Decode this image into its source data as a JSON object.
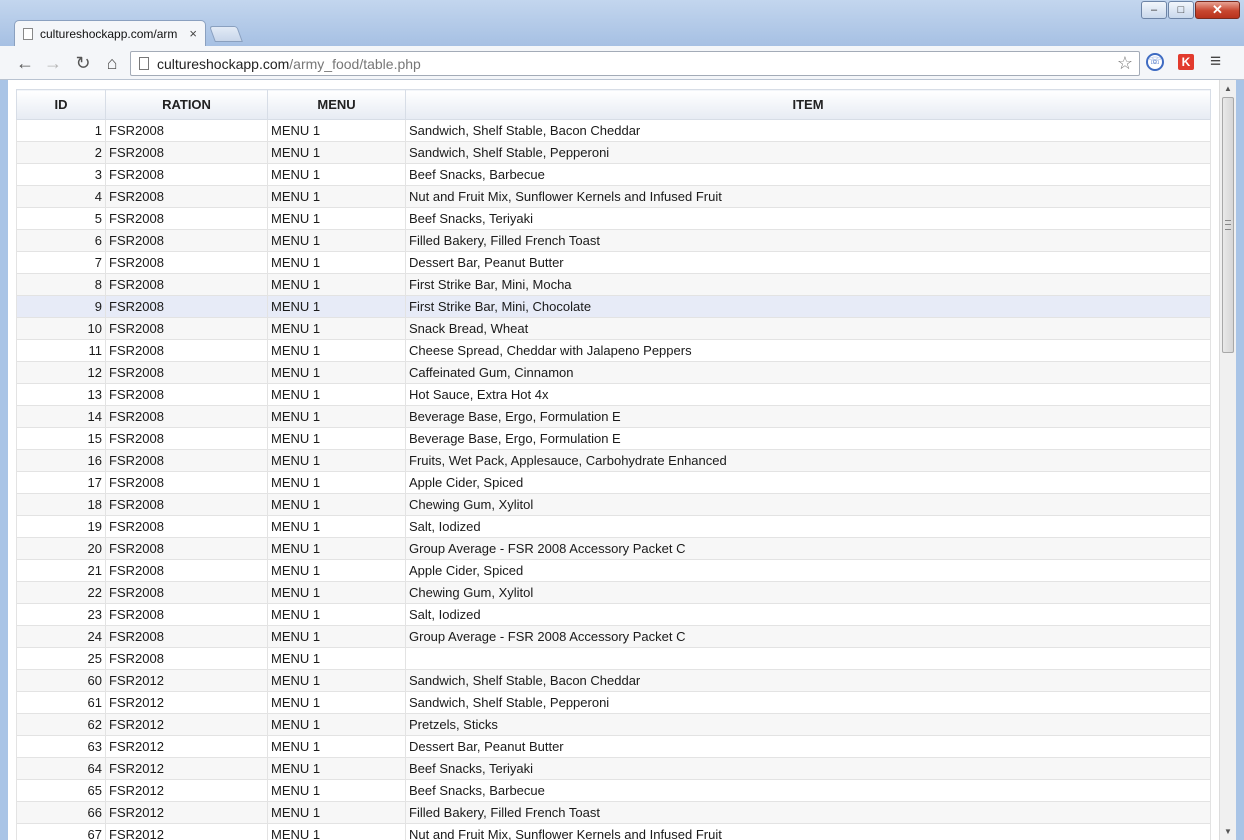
{
  "window": {
    "minimize_glyph": "–",
    "maximize_glyph": "□",
    "close_glyph": "✕"
  },
  "tab": {
    "title": "cultureshockapp.com/arm",
    "close_glyph": "×"
  },
  "toolbar": {
    "back_glyph": "←",
    "forward_glyph": "→",
    "reload_glyph": "↻",
    "home_glyph": "⌂",
    "url_host": "cultureshockapp.com",
    "url_path": "/army_food/table.php",
    "bookmark_glyph": "☆",
    "menu_glyph": "≡",
    "icons": [
      "back-icon",
      "forward-icon",
      "reload-icon",
      "home-icon",
      "star-icon",
      "phone-extension-icon",
      "red-extension-icon",
      "menu-icon"
    ]
  },
  "table": {
    "headers": [
      "ID",
      "RATION",
      "MENU",
      "ITEM"
    ],
    "selected_id": "9",
    "rows": [
      [
        "1",
        "FSR2008",
        "MENU 1",
        "Sandwich, Shelf Stable, Bacon Cheddar"
      ],
      [
        "2",
        "FSR2008",
        "MENU 1",
        "Sandwich, Shelf Stable, Pepperoni"
      ],
      [
        "3",
        "FSR2008",
        "MENU 1",
        "Beef Snacks, Barbecue"
      ],
      [
        "4",
        "FSR2008",
        "MENU 1",
        "Nut and Fruit Mix, Sunflower Kernels and Infused Fruit"
      ],
      [
        "5",
        "FSR2008",
        "MENU 1",
        "Beef Snacks, Teriyaki"
      ],
      [
        "6",
        "FSR2008",
        "MENU 1",
        "Filled Bakery, Filled French Toast"
      ],
      [
        "7",
        "FSR2008",
        "MENU 1",
        "Dessert Bar, Peanut Butter"
      ],
      [
        "8",
        "FSR2008",
        "MENU 1",
        "First Strike Bar, Mini, Mocha"
      ],
      [
        "9",
        "FSR2008",
        "MENU 1",
        "First Strike Bar, Mini, Chocolate"
      ],
      [
        "10",
        "FSR2008",
        "MENU 1",
        "Snack Bread, Wheat"
      ],
      [
        "11",
        "FSR2008",
        "MENU 1",
        "Cheese Spread, Cheddar with Jalapeno Peppers"
      ],
      [
        "12",
        "FSR2008",
        "MENU 1",
        "Caffeinated Gum, Cinnamon"
      ],
      [
        "13",
        "FSR2008",
        "MENU 1",
        "Hot Sauce, Extra Hot 4x"
      ],
      [
        "14",
        "FSR2008",
        "MENU 1",
        "Beverage Base, Ergo, Formulation E"
      ],
      [
        "15",
        "FSR2008",
        "MENU 1",
        "Beverage Base, Ergo, Formulation E"
      ],
      [
        "16",
        "FSR2008",
        "MENU 1",
        "Fruits, Wet Pack, Applesauce, Carbohydrate Enhanced"
      ],
      [
        "17",
        "FSR2008",
        "MENU 1",
        "Apple Cider, Spiced"
      ],
      [
        "18",
        "FSR2008",
        "MENU 1",
        "Chewing Gum, Xylitol"
      ],
      [
        "19",
        "FSR2008",
        "MENU 1",
        "Salt, Iodized"
      ],
      [
        "20",
        "FSR2008",
        "MENU 1",
        "Group Average - FSR 2008 Accessory Packet C"
      ],
      [
        "21",
        "FSR2008",
        "MENU 1",
        "Apple Cider, Spiced"
      ],
      [
        "22",
        "FSR2008",
        "MENU 1",
        "Chewing Gum, Xylitol"
      ],
      [
        "23",
        "FSR2008",
        "MENU 1",
        "Salt, Iodized"
      ],
      [
        "24",
        "FSR2008",
        "MENU 1",
        "Group Average - FSR 2008 Accessory Packet C"
      ],
      [
        "25",
        "FSR2008",
        "MENU 1",
        ""
      ],
      [
        "60",
        "FSR2012",
        "MENU 1",
        "Sandwich, Shelf Stable, Bacon Cheddar"
      ],
      [
        "61",
        "FSR2012",
        "MENU 1",
        "Sandwich, Shelf Stable, Pepperoni"
      ],
      [
        "62",
        "FSR2012",
        "MENU 1",
        "Pretzels, Sticks"
      ],
      [
        "63",
        "FSR2012",
        "MENU 1",
        "Dessert Bar, Peanut Butter"
      ],
      [
        "64",
        "FSR2012",
        "MENU 1",
        "Beef Snacks, Teriyaki"
      ],
      [
        "65",
        "FSR2012",
        "MENU 1",
        "Beef Snacks, Barbecue"
      ],
      [
        "66",
        "FSR2012",
        "MENU 1",
        "Filled Bakery, Filled French Toast"
      ],
      [
        "67",
        "FSR2012",
        "MENU 1",
        "Nut and Fruit Mix, Sunflower Kernels and Infused Fruit"
      ]
    ]
  },
  "scrollbar": {
    "up_glyph": "▲",
    "down_glyph": "▼",
    "position_fraction": 0.0
  }
}
